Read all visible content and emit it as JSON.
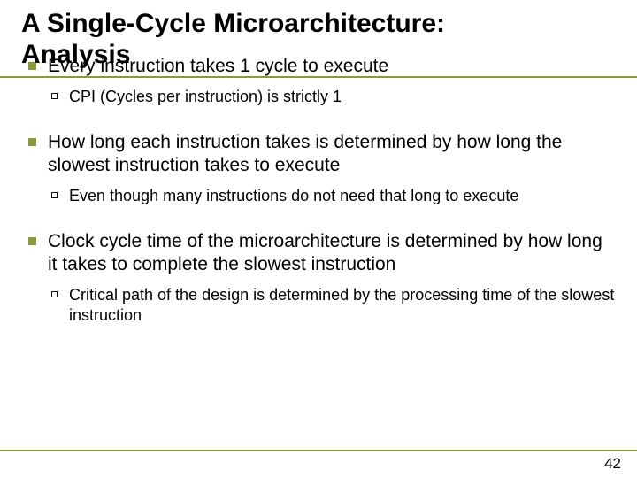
{
  "title": {
    "line1": "A Single-Cycle Microarchitecture:",
    "line2": "Analysis"
  },
  "bullets": [
    {
      "text": "Every instruction takes 1 cycle to execute",
      "sub": [
        {
          "text": "CPI (Cycles per instruction) is strictly 1"
        }
      ]
    },
    {
      "text": "How long each instruction takes is determined by how long the slowest instruction takes to execute",
      "sub": [
        {
          "text": "Even though many instructions do not need that long to execute"
        }
      ]
    },
    {
      "text": "Clock cycle time of the microarchitecture is determined by how long it takes to complete the slowest instruction",
      "sub": [
        {
          "text": "Critical path of the design is determined by the processing time of the slowest instruction"
        }
      ]
    }
  ],
  "page_number": "42"
}
